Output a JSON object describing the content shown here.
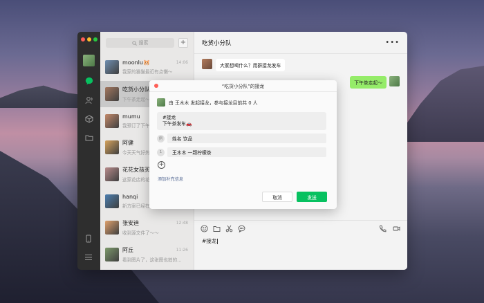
{
  "search": {
    "placeholder": "搜索"
  },
  "chats": [
    {
      "name": "moonlu🐹",
      "preview": "我家的猫猫最近有点懒～",
      "time": "14:06",
      "color": "#6f8fb1"
    },
    {
      "name": "吃货小分队",
      "preview": "下午茶走起～",
      "time": "",
      "color": "#a4785f",
      "active": true
    },
    {
      "name": "mumu",
      "preview": "我预订了下午茶",
      "time": "",
      "color": "#c48a6a"
    },
    {
      "name": "阿健",
      "preview": "今天天气好热",
      "time": "",
      "color": "#d6a35c"
    },
    {
      "name": "花花女孩买衣服",
      "preview": "这家花店的花",
      "time": "",
      "color": "#b88c8c"
    },
    {
      "name": "hanqi",
      "preview": "新方案已经在",
      "time": "",
      "color": "#4c7fb0"
    },
    {
      "name": "张安迪",
      "preview": "收到源文件了～～",
      "time": "12:48",
      "color": "#e0a16d"
    },
    {
      "name": "阿丘",
      "preview": "看到图片了，这张图也拍的...",
      "time": "11:26",
      "color": "#7d9a6b"
    }
  ],
  "main": {
    "title": "吃货小分队",
    "more": "•••",
    "msg_left": "大家想喝什么？用群接龙发车",
    "msg_right": "下午茶走起～",
    "input_text": "#接龙"
  },
  "dialog": {
    "title": "“吃货小分队”的接龙",
    "info": "由 王木木 发起接龙，参与接龙目前共 0 人",
    "note_line1": "#接龙",
    "note_line2": "下午茶发车🚗",
    "example_idx": "例",
    "example_text": "姓名 饮品",
    "row1_idx": "1",
    "row1_text": "王木木 一颗柠檬茶",
    "add_extra": "添加补充信息",
    "cancel": "取消",
    "send": "发送"
  }
}
